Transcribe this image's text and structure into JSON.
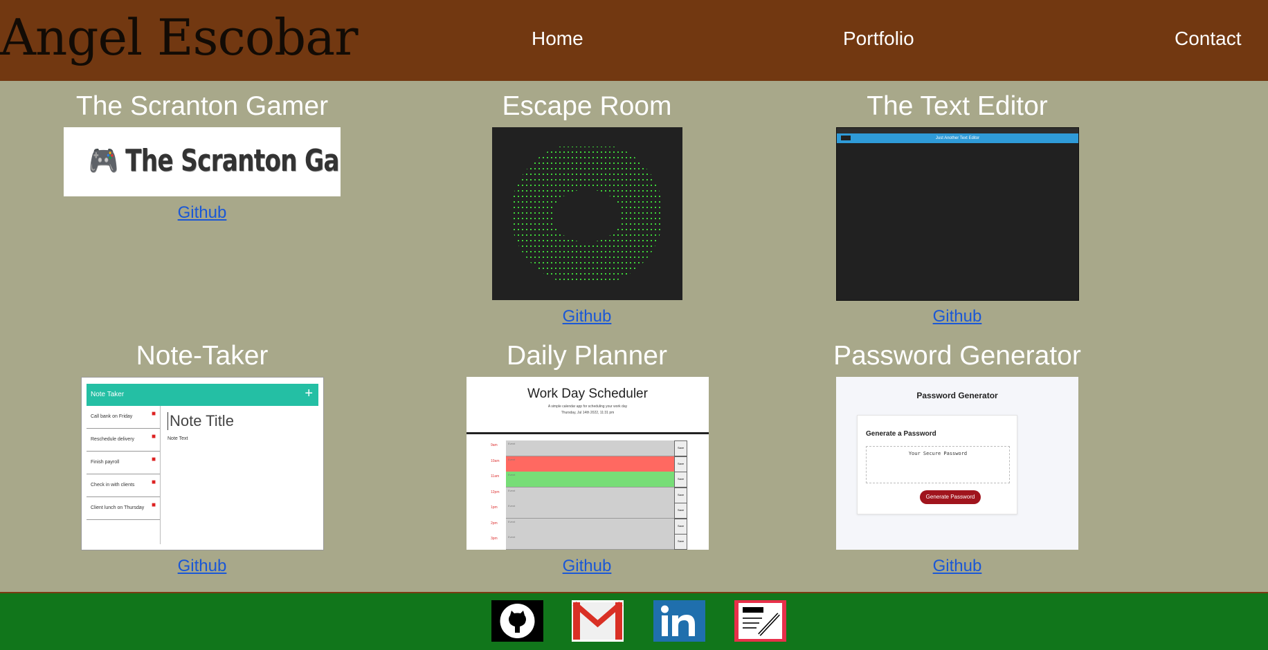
{
  "header": {
    "brand": "Angel Escobar",
    "nav": [
      "Home",
      "Portfolio",
      "Contact"
    ]
  },
  "projects": [
    {
      "title": "The Scranton Gamer",
      "link": "Github",
      "shot_text": "🎮 The Scranton Gamer 🎮"
    },
    {
      "title": "Escape Room",
      "link": "Github"
    },
    {
      "title": "The Text Editor",
      "link": "Github",
      "shot_text": "Just Another Text Editor"
    },
    {
      "title": "Note-Taker",
      "link": "Github"
    },
    {
      "title": "Daily Planner",
      "link": "Github"
    },
    {
      "title": "Password Generator",
      "link": "Github"
    }
  ],
  "note_taker": {
    "bar_title": "Note Taker",
    "items": [
      "Call bank on Friday",
      "Reschedule delivery",
      "Finish payroll",
      "Check in with clients",
      "Client lunch on Thursday"
    ],
    "title_placeholder": "Note Title",
    "text_placeholder": "Note Text"
  },
  "planner": {
    "title": "Work Day Scheduler",
    "subtitle": "A simple calendar app for scheduling your work day",
    "date": "Thursday, Jul 14th 2022, 11:31 pm",
    "hours": [
      "9am",
      "10am",
      "11am",
      "12pm",
      "1pm",
      "2pm",
      "3pm"
    ],
    "event_placeholder": "Event",
    "save": "Save",
    "row_colors": [
      "#cfcfcf",
      "#ff6961",
      "#77dd77",
      "#cfcfcf",
      "#cfcfcf",
      "#cfcfcf",
      "#cfcfcf"
    ]
  },
  "password": {
    "heading": "Password Generator",
    "card_title": "Generate a Password",
    "placeholder": "Your Secure Password",
    "button": "Generate Password"
  },
  "footer": {
    "icons": [
      "github-icon",
      "gmail-icon",
      "linkedin-icon",
      "resume-icon"
    ]
  },
  "colors": {
    "header_bg": "#723811",
    "page_bg": "#a8a88a",
    "footer_bg": "#11761b",
    "link": "#1a57d6"
  }
}
